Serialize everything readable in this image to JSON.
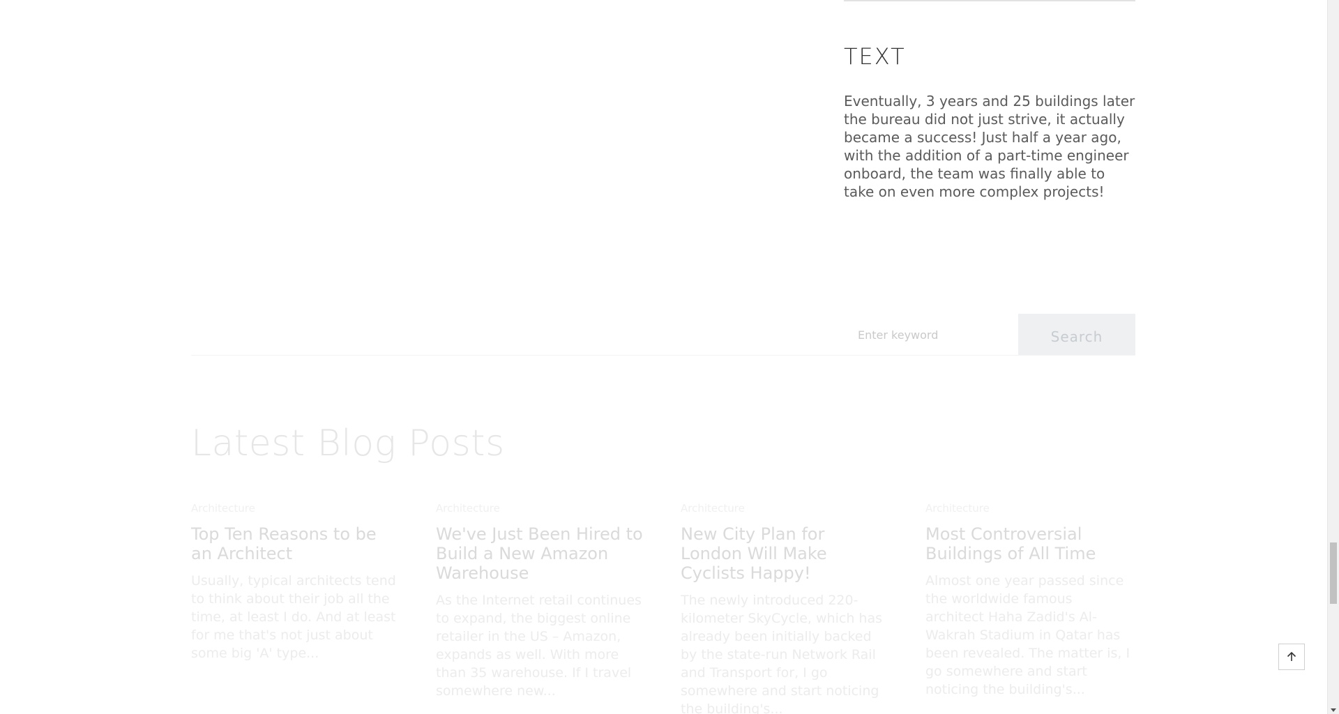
{
  "widget": {
    "title": "TEXT",
    "text": "Eventually, 3 years and 25 buildings later the bureau did not just strive, it actually became a success! Just half a year ago, with the addition of a part-time engineer onboard, the team was finally able to take on even more complex projects!"
  },
  "search": {
    "placeholder": "Enter keyword",
    "button_label": "Search"
  },
  "blog": {
    "heading": "Latest Blog Posts",
    "posts": [
      {
        "category": "Architecture",
        "title": "Top Ten Reasons to be an Architect",
        "excerpt": "Usually, typical architects tend to think about their job all the time, at least I do. And at least for me that's not just about some big 'A' type..."
      },
      {
        "category": "Architecture",
        "title": "We've Just Been Hired to Build a New Amazon Warehouse",
        "excerpt": "As the Internet retail continues to expand, the biggest online retailer in the US – Amazon, expands as well. With more than 35 warehouse. If I travel somewhere new..."
      },
      {
        "category": "Architecture",
        "title": "New City Plan for London Will Make Cyclists Happy!",
        "excerpt": "The newly introduced 220-kilometer SkyCycle, which has already been initially backed by the state-run Network Rail and Transport for, I go somewhere and start noticing the building's..."
      },
      {
        "category": "Architecture",
        "title": "Most Controversial Buildings of All Time",
        "excerpt": "Almost one year passed since the worldwide famous architect Haha Zadid's Al-Wakrah Stadium in Qatar has been revealed. The matter is, I go somewhere and start noticing the building's..."
      }
    ]
  },
  "icons": {
    "back_to_top": "arrow-up-icon",
    "scroll_down": "scroll-down-arrow-icon"
  }
}
